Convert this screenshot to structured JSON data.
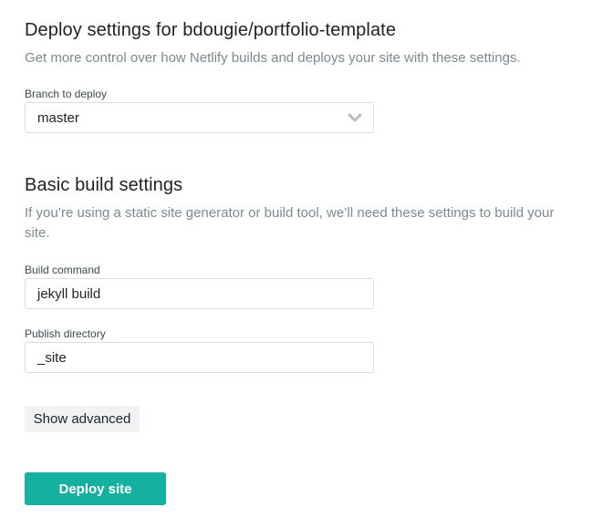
{
  "deploy_settings": {
    "heading": "Deploy settings for bdougie/portfolio-template",
    "description": "Get more control over how Netlify builds and deploys your site with these settings.",
    "branch_label": "Branch to deploy",
    "branch_value": "master",
    "branch_icon": "chevron-down-icon"
  },
  "build_settings": {
    "heading": "Basic build settings",
    "description_line1": "If you’re using a static site generator or build tool, we’ll need these settings to build your",
    "description_line2": "site.",
    "command_label": "Build command",
    "command_value": "jekyll build",
    "publish_label": "Publish directory",
    "publish_value": "_site"
  },
  "actions": {
    "show_advanced_label": "Show advanced",
    "deploy_label": "Deploy site"
  },
  "colors": {
    "primary_button": "#16b0a0",
    "muted_text": "#7a8a90",
    "input_border": "#d8dde0",
    "secondary_button": "#f0f2f3"
  }
}
